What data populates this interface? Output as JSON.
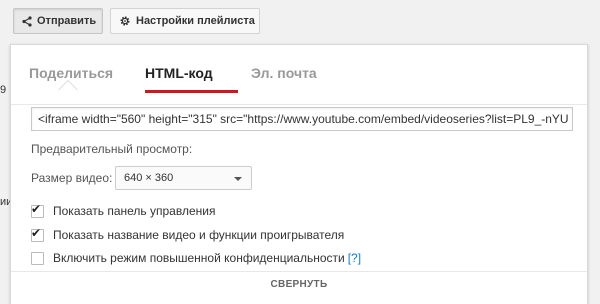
{
  "toolbar": {
    "share_label": "Отправить",
    "settings_label": "Настройки плейлиста"
  },
  "side_fragments": [
    "9",
    "ии"
  ],
  "share_panel": {
    "tabs": [
      {
        "label": "Поделиться",
        "active": false
      },
      {
        "label": "HTML-код",
        "active": true
      },
      {
        "label": "Эл. почта",
        "active": false
      }
    ],
    "embed_code": "<iframe width=\"560\" height=\"315\" src=\"https://www.youtube.com/embed/videoseries?list=PL9_-nYU",
    "preview_label": "Предварительный просмотр:",
    "size_label": "Размер видео:",
    "size_value": "640 × 360",
    "options": [
      {
        "label": "Показать панель управления",
        "checked": true
      },
      {
        "label": "Показать название видео и функции проигрывателя",
        "checked": true
      },
      {
        "label": "Включить режим повышенной конфиденциальности",
        "checked": false,
        "help": "[?]"
      }
    ],
    "collapse_label": "СВЕРНУТЬ",
    "accent_color": "#cc181e"
  }
}
